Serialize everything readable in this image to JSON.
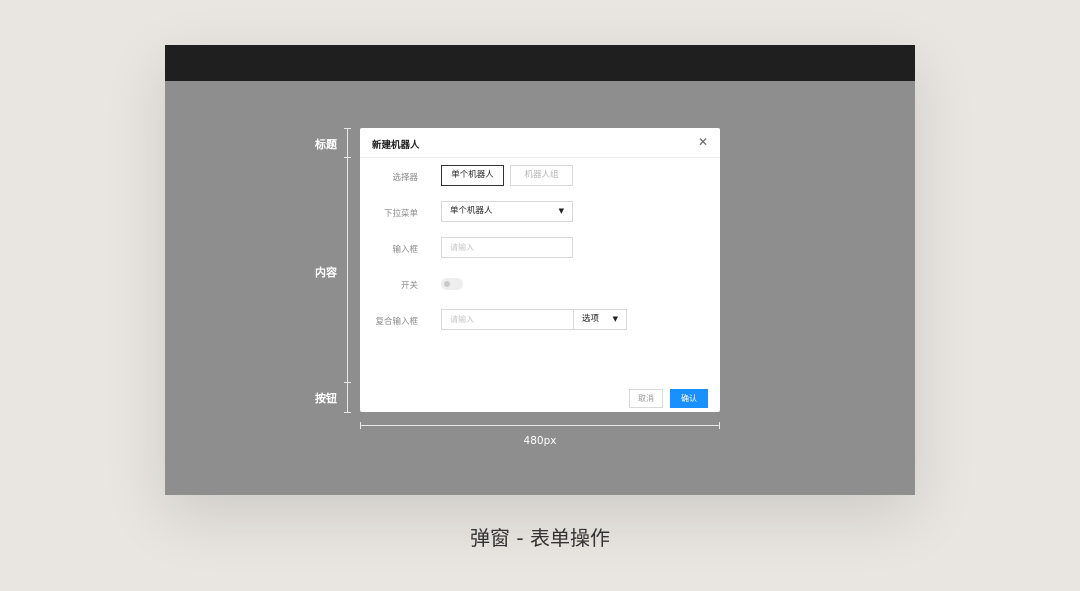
{
  "annotations": {
    "title_label": "标题",
    "content_label": "内容",
    "buttons_label": "按钮",
    "width_label": "480px"
  },
  "dialog": {
    "title": "新建机器人",
    "close_icon": "close-icon",
    "rows": {
      "selector": {
        "label": "选择器",
        "options": [
          "单个机器人",
          "机器人组"
        ],
        "selected": "单个机器人"
      },
      "dropdown": {
        "label": "下拉菜单",
        "value": "单个机器人"
      },
      "input": {
        "label": "输入框",
        "placeholder": "请输入"
      },
      "switch": {
        "label": "开关",
        "on": false
      },
      "compound": {
        "label": "复合输入框",
        "placeholder": "请输入",
        "select_value": "选项"
      }
    },
    "footer": {
      "cancel_label": "取消",
      "confirm_label": "确认"
    }
  },
  "caption": "弹窗 - 表单操作",
  "colors": {
    "page_bg": "#e9e6e1",
    "overlay": "#8e8e8e",
    "topbar": "#1f1f1f",
    "primary": "#1890ff"
  }
}
